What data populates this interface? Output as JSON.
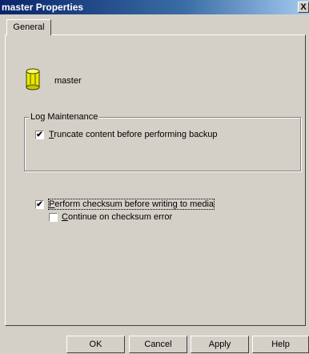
{
  "window": {
    "title": "master Properties",
    "close_glyph": "X"
  },
  "tabs": [
    {
      "label": "General"
    }
  ],
  "database": {
    "name": "master",
    "icon": "database-cylinder-icon",
    "icon_color": "#e8e800"
  },
  "log_maintenance": {
    "title": "Log Maintenance",
    "truncate": {
      "mnemonic": "T",
      "rest": "runcate content before performing backup",
      "checked": true
    }
  },
  "checksum": {
    "perform": {
      "mnemonic": "P",
      "rest": "erform checksum before writing to media",
      "checked": true
    },
    "continue_on_error": {
      "mnemonic": "C",
      "rest": "ontinue on checksum error",
      "checked": false
    }
  },
  "buttons": {
    "ok": "OK",
    "cancel": "Cancel",
    "apply": "Apply",
    "help": "Help"
  },
  "check_glyph": "✔"
}
